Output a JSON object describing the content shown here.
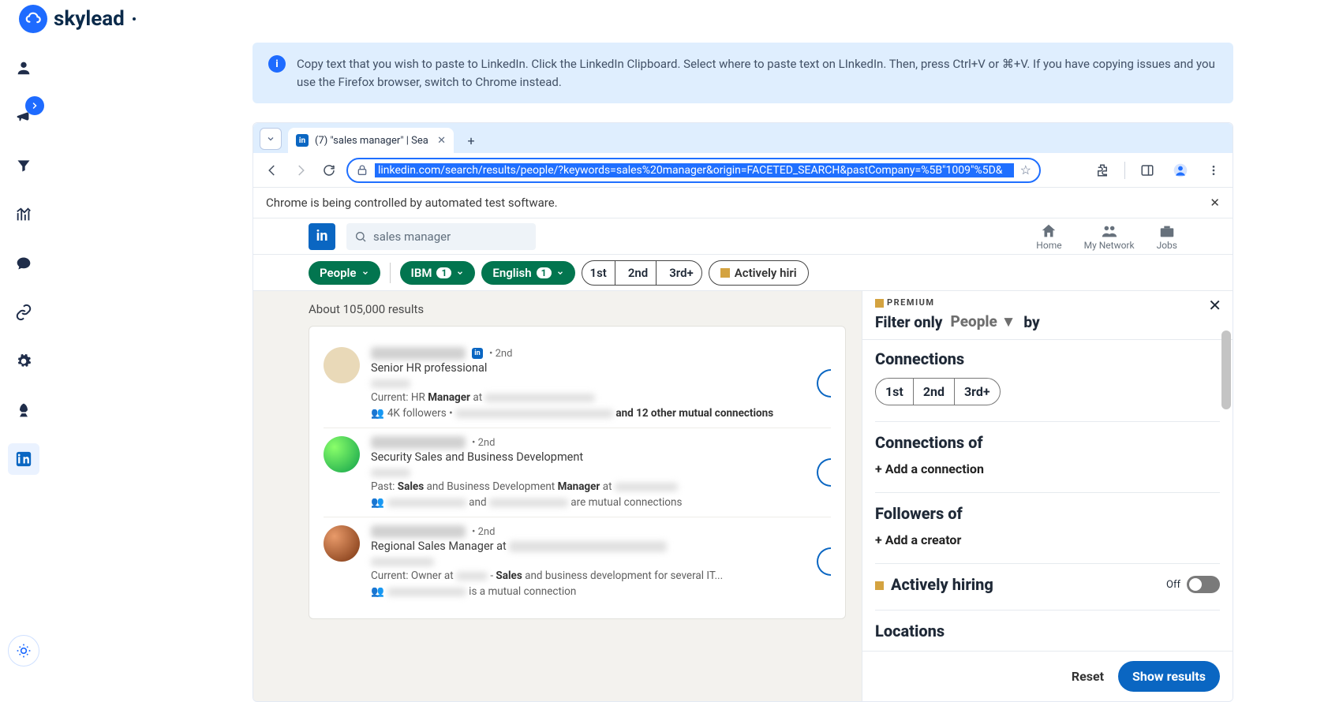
{
  "logo": {
    "text": "skylead"
  },
  "info_banner": {
    "text": "Copy text that you wish to paste to LinkedIn. Click the LinkedIn Clipboard. Select where to paste text on LInkedIn. Then, press Ctrl+V or ⌘+V. If you have copying issues and you use the Firefox browser, switch to Chrome instead."
  },
  "tab": {
    "title": "(7) \"sales manager\" | Sea"
  },
  "url": "linkedin.com/search/results/people/?keywords=sales%20manager&origin=FACETED_SEARCH&pastCompany=%5B\"1009\"%5D&",
  "automation_banner": "Chrome is being controlled by automated test software.",
  "linkedin": {
    "search_value": "sales manager",
    "nav": {
      "home": "Home",
      "network": "My Network",
      "jobs": "Jobs"
    },
    "filters": {
      "people": "People",
      "ibm": "IBM",
      "ibm_count": "1",
      "english": "English",
      "english_count": "1",
      "c1": "1st",
      "c2": "2nd",
      "c3": "3rd+",
      "hiring": "Actively hiri"
    },
    "results_count": "About 105,000 results",
    "results": [
      {
        "degree": "• 2nd",
        "title": "Senior HR professional",
        "current_pre": "Current: HR ",
        "current_bold": "Manager",
        "current_post": " at ",
        "followers": "4K followers • ",
        "mutual": " and 12 other mutual connections"
      },
      {
        "degree": "• 2nd",
        "title": "Security Sales and Business Development",
        "past_pre": "Past: ",
        "past_b1": "Sales",
        "past_mid": " and Business Development ",
        "past_b2": "Manager",
        "past_post": " at ",
        "mutual_mid": " and ",
        "mutual_post": " are mutual connections"
      },
      {
        "degree": "• 2nd",
        "title_pre": "Regional Sales Manager at ",
        "current_pre": "Current: Owner at ",
        "current_mid": " - ",
        "current_bold": "Sales",
        "current_post": " and business development for several IT...",
        "mutual_post": " is a mutual connection"
      }
    ]
  },
  "panel": {
    "premium": "PREMIUM",
    "filter_only": "Filter only",
    "people": "People",
    "by": "by",
    "connections": "Connections",
    "c1": "1st",
    "c2": "2nd",
    "c3": "3rd+",
    "connections_of": "Connections of",
    "add_connection": "+ Add a connection",
    "followers_of": "Followers of",
    "add_creator": "+ Add a creator",
    "actively_hiring": "Actively hiring",
    "off": "Off",
    "locations": "Locations",
    "reset": "Reset",
    "show": "Show results"
  }
}
